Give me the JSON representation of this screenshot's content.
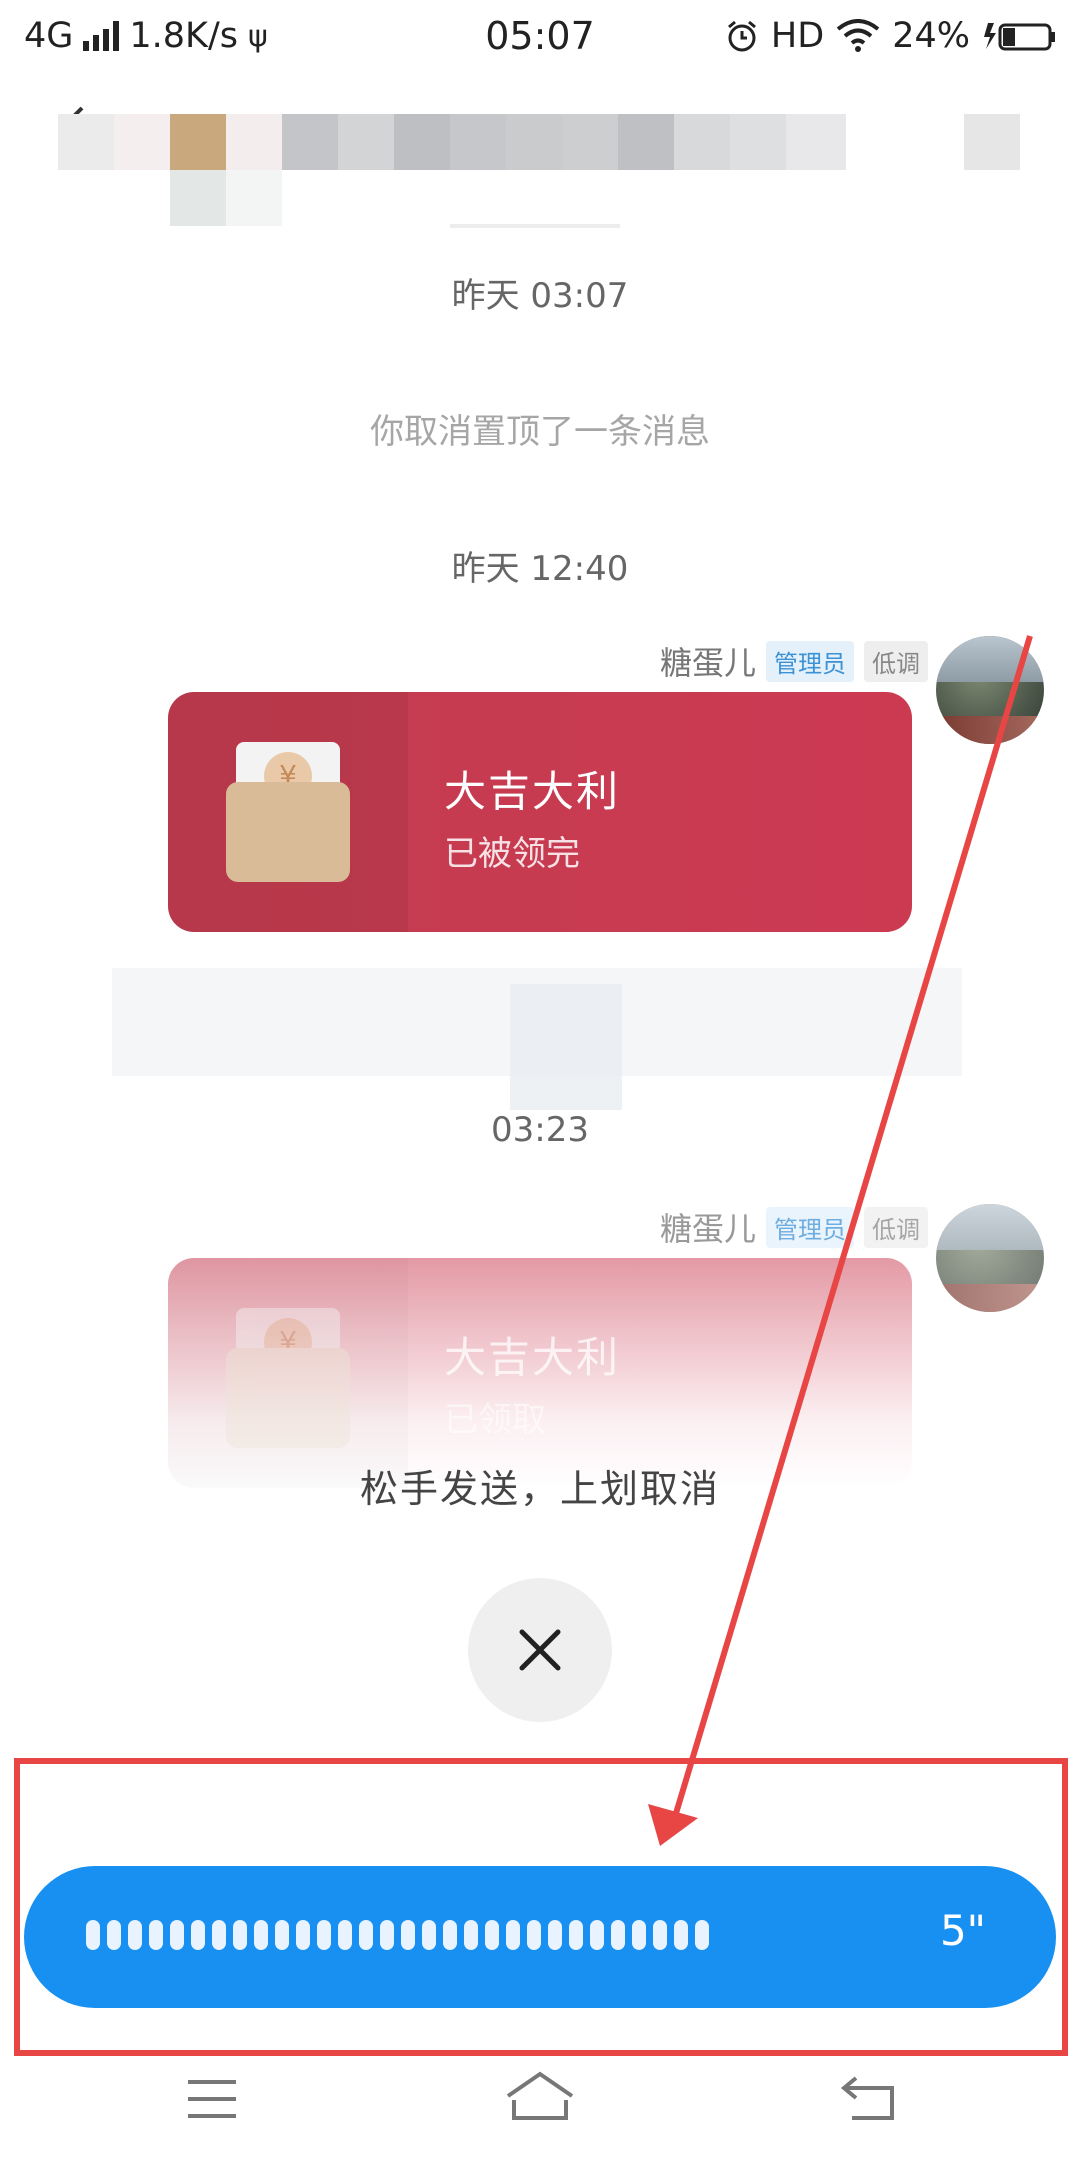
{
  "status_bar": {
    "network": "4G",
    "speed": "1.8K/s",
    "time": "05:07",
    "hd": "HD",
    "battery": "24%"
  },
  "chat": {
    "time_labels": [
      "昨天 03:07",
      "昨天 12:40",
      "03:23"
    ],
    "system_message": "你取消置顶了一条消息",
    "messages": [
      {
        "sender": "糖蛋儿",
        "badges": [
          "管理员",
          "低调"
        ],
        "red_packet": {
          "title": "大吉大利",
          "status": "已被领完",
          "currency_icon": "¥"
        }
      },
      {
        "sender": "糖蛋儿",
        "badges": [
          "管理员",
          "低调"
        ],
        "red_packet": {
          "title": "大吉大利",
          "status": "已领取",
          "currency_icon": "¥"
        }
      }
    ]
  },
  "voice_recording": {
    "hint": "松手发送，上划取消",
    "duration": "5\""
  },
  "colors": {
    "accent_blue": "#1890f2",
    "red_packet": "#c8394f",
    "annotation_red": "#e84545"
  },
  "icons": {
    "cancel": "close-icon",
    "nav": [
      "menu-icon",
      "home-icon",
      "back-icon"
    ]
  }
}
